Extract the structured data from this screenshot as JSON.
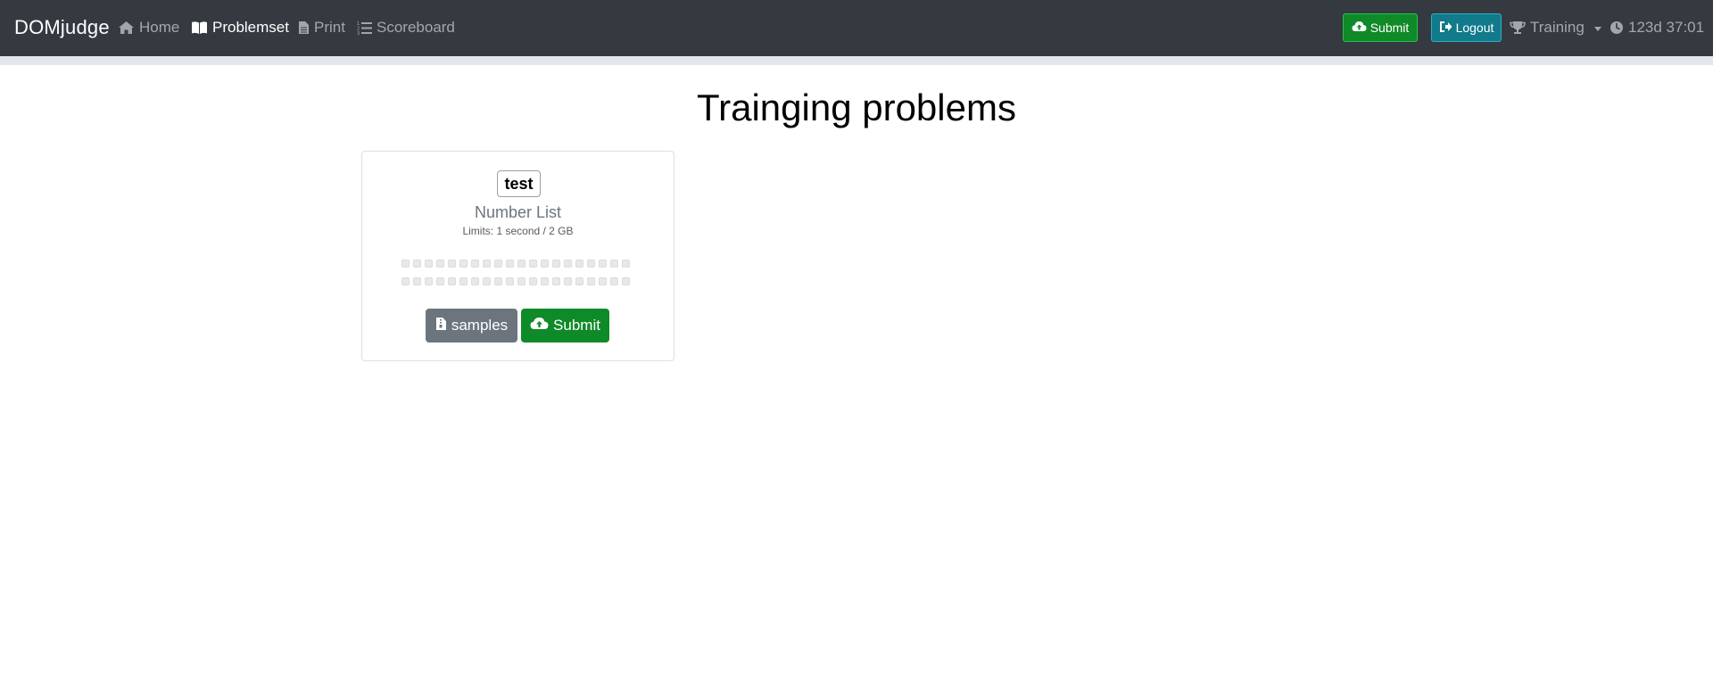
{
  "navbar": {
    "brand": "DOMjudge",
    "links": [
      {
        "label": "Home",
        "icon": "home-icon",
        "active": false
      },
      {
        "label": "Problemset",
        "icon": "book-open-icon",
        "active": true
      },
      {
        "label": "Print",
        "icon": "file-icon",
        "active": false
      },
      {
        "label": "Scoreboard",
        "icon": "list-ol-icon",
        "active": false
      }
    ],
    "submit_label": "Submit",
    "logout_label": "Logout",
    "contest_label": "Training",
    "clock": "123d 37:01"
  },
  "main": {
    "title": "Trainging problems",
    "problems": [
      {
        "badge": "test",
        "name": "Number List",
        "limits": "Limits: 1 second / 2 GB",
        "samples_label": "samples",
        "submit_label": "Submit"
      }
    ]
  },
  "colors": {
    "navbar_bg": "#343a40",
    "success": "#0f8a28",
    "info": "#117a8b",
    "secondary": "#6c757d"
  }
}
